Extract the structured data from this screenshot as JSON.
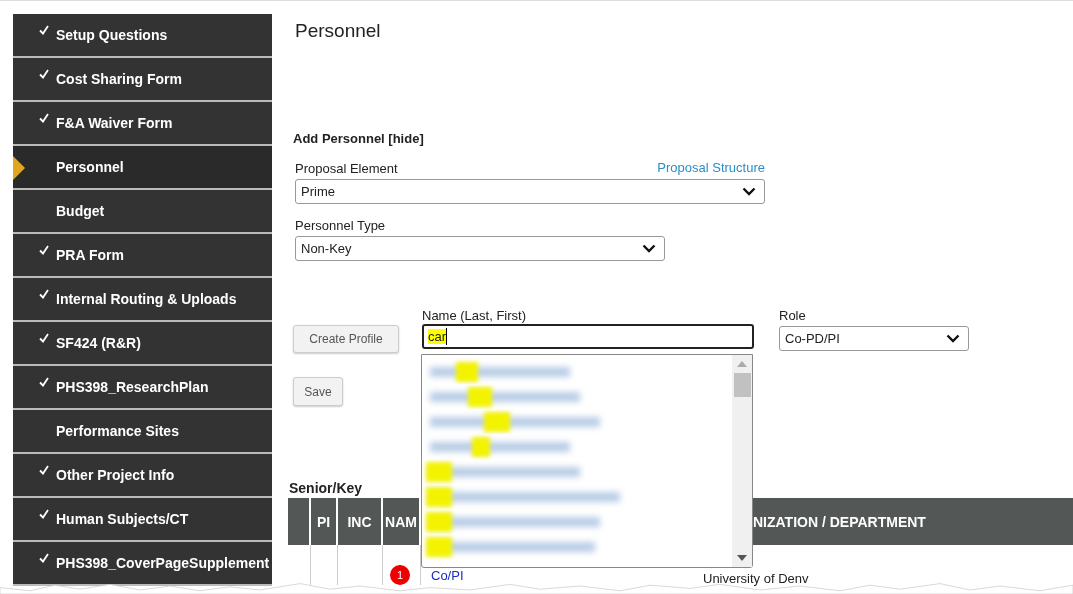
{
  "sidebar": {
    "items": [
      {
        "label": "Setup Questions",
        "done": true,
        "selected": false
      },
      {
        "label": "Cost Sharing Form",
        "done": true,
        "selected": false
      },
      {
        "label": "F&A Waiver Form",
        "done": true,
        "selected": false
      },
      {
        "label": "Personnel",
        "done": false,
        "selected": true
      },
      {
        "label": "Budget",
        "done": false,
        "selected": false
      },
      {
        "label": "PRA Form",
        "done": true,
        "selected": false
      },
      {
        "label": "Internal Routing & Uploads",
        "done": true,
        "selected": false
      },
      {
        "label": "SF424 (R&R)",
        "done": true,
        "selected": false
      },
      {
        "label": "PHS398_ResearchPlan",
        "done": true,
        "selected": false
      },
      {
        "label": "Performance Sites",
        "done": false,
        "selected": false
      },
      {
        "label": "Other Project Info",
        "done": true,
        "selected": false
      },
      {
        "label": "Human Subjects/CT",
        "done": true,
        "selected": false
      },
      {
        "label": "PHS398_CoverPageSupplement",
        "done": true,
        "selected": false
      }
    ]
  },
  "page": {
    "title": "Personnel",
    "section_title": "Add Personnel [hide]",
    "proposal_element": {
      "label": "Proposal Element",
      "link": "Proposal Structure",
      "value": "Prime"
    },
    "personnel_type": {
      "label": "Personnel Type",
      "value": "Non-Key"
    },
    "create_profile_button": "Create Profile",
    "name": {
      "label": "Name (Last, First)",
      "value": "car"
    },
    "role": {
      "label": "Role",
      "value": "Co-PD/PI"
    },
    "save_button": "Save"
  },
  "senior_key": {
    "title": "Senior/Key",
    "columns": [
      "PI",
      "INC",
      "NAM",
      "NIZATION / DEPARTMENT"
    ],
    "row": {
      "badge": "1",
      "role": "Co/PI",
      "organization": "University of Denv"
    }
  }
}
